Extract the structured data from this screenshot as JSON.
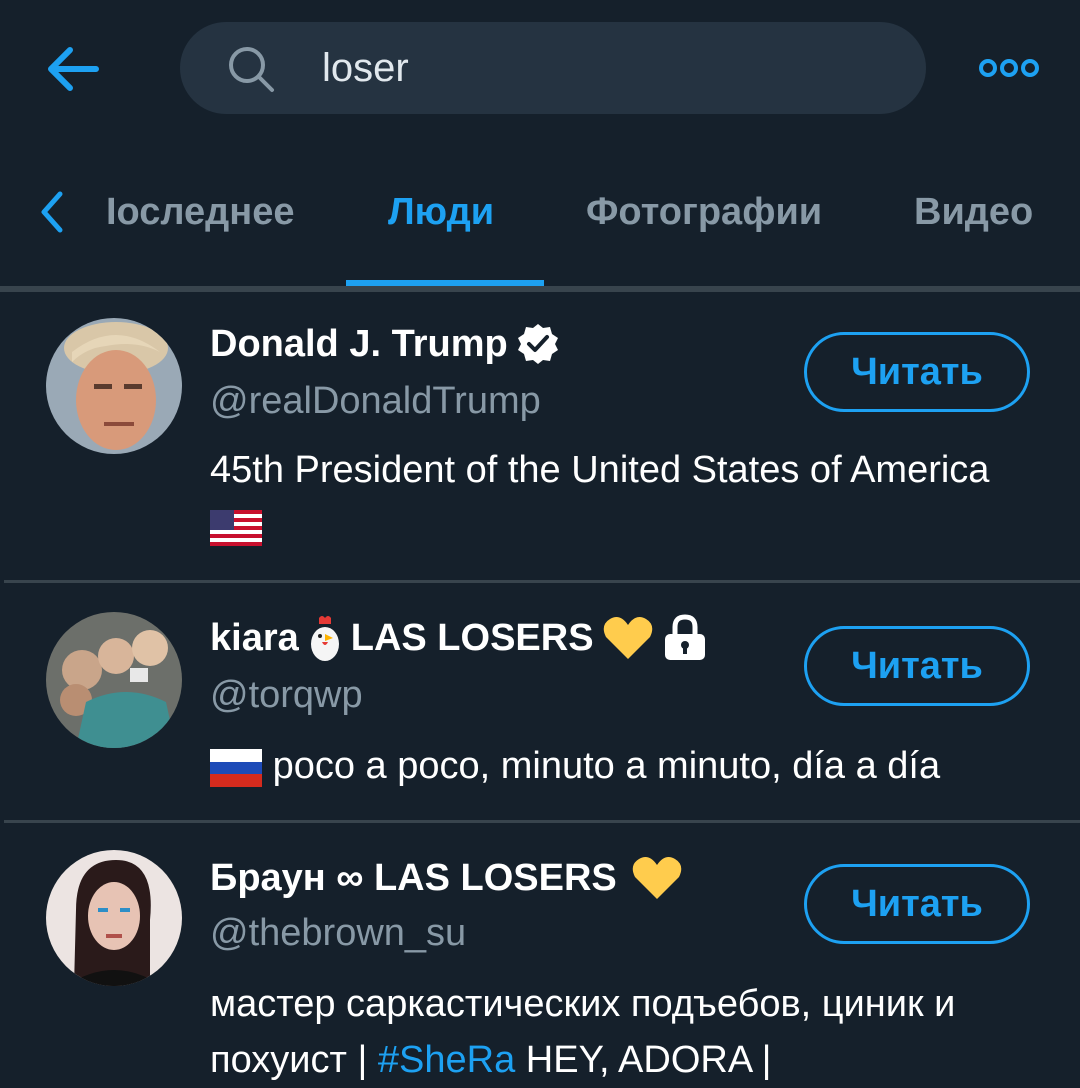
{
  "header": {
    "search_query": "loser"
  },
  "tabs": {
    "latest": "Iоследнее",
    "people": "Люди",
    "photos": "Фотографии",
    "video": "Видео"
  },
  "results": [
    {
      "name": "Donald J. Trump",
      "handle": "@realDonaldTrump",
      "bio": "45th President of the United States of America",
      "follow_label": "Читать"
    },
    {
      "name_part1": "kiara",
      "name_part2": "LAS LOSERS",
      "handle": "@torqwp",
      "bio": "poco a poco, minuto a minuto, día a día",
      "follow_label": "Читать"
    },
    {
      "name": "Браун ∞ LAS LOSERS",
      "handle": "@thebrown_su",
      "bio_part1": "мастер саркастических подъебов, циник и похуист |",
      "bio_hashtag": "#SheRa",
      "bio_part2": "HEY, ADORA |",
      "follow_label": "Читать"
    }
  ],
  "colors": {
    "background": "#15202b",
    "accent": "#1da1f2",
    "muted": "#8899a6",
    "divider": "#38444d"
  }
}
